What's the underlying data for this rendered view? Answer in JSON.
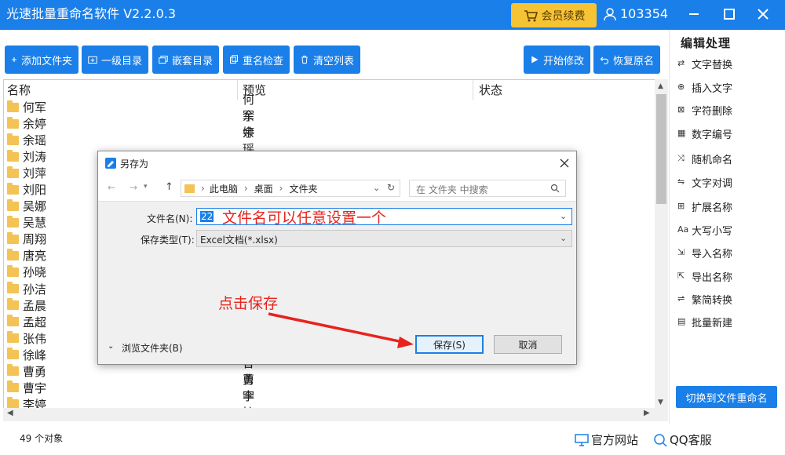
{
  "app": {
    "title": "光速批量重命名软件 V2.2.0.3",
    "vip_label": "会员续费",
    "user_id": "103354",
    "accent": "#1a7fe8",
    "vip_color": "#f6c335"
  },
  "toolbar": {
    "add_files": "添加文件夹",
    "first_level": "一级目录",
    "nested": "嵌套目录",
    "rename_check": "重名检查",
    "clear_list": "清空列表",
    "start": "开始修改",
    "restore": "恢复原名"
  },
  "list": {
    "columns": [
      "名称",
      "预览",
      "状态"
    ],
    "names": [
      "何军",
      "余婷",
      "余瑶",
      "刘涛",
      "刘萍",
      "刘阳",
      "吴娜",
      "吴慧",
      "周翔",
      "唐亮",
      "孙晓",
      "孙洁",
      "孟晨",
      "孟超",
      "张伟",
      "徐峰",
      "曹勇",
      "曹宇",
      "李婷"
    ],
    "previews": [
      "何军",
      "余婷",
      "余瑶",
      "",
      "",
      "",
      "",
      "",
      "",
      "",
      "",
      "",
      "",
      "",
      "",
      "",
      "曹勇",
      "曹宇",
      "李婷"
    ]
  },
  "sidebar": {
    "title": "编辑处理",
    "items": [
      {
        "label": "文字替换",
        "icon": "replace-icon"
      },
      {
        "label": "插入文字",
        "icon": "insert-icon"
      },
      {
        "label": "字符删除",
        "icon": "delete-char-icon"
      },
      {
        "label": "数字编号",
        "icon": "number-icon"
      },
      {
        "label": "随机命名",
        "icon": "shuffle-icon"
      },
      {
        "label": "文字对调",
        "icon": "swap-icon"
      },
      {
        "label": "扩展名称",
        "icon": "extension-icon"
      },
      {
        "label": "大写小写",
        "icon": "case-icon"
      },
      {
        "label": "导入名称",
        "icon": "import-icon"
      },
      {
        "label": "导出名称",
        "icon": "export-icon"
      },
      {
        "label": "繁简转换",
        "icon": "convert-icon"
      },
      {
        "label": "批量新建",
        "icon": "new-icon"
      }
    ],
    "switch_label": "切换到文件重命名"
  },
  "status": {
    "count": "49  个对象",
    "website": "官方网站",
    "qq": "QQ客服"
  },
  "dialog": {
    "title": "另存为",
    "breadcrumb": [
      "此电脑",
      "桌面",
      "文件夹"
    ],
    "search_placeholder": "在 文件夹 中搜索",
    "filename_label": "文件名(N):",
    "filename_value": "22",
    "filetype_label": "保存类型(T):",
    "filetype_value": "Excel文档(*.xlsx)",
    "browse_label": "浏览文件夹(B)",
    "save_label": "保存(S)",
    "cancel_label": "取消"
  },
  "annotations": {
    "filename_hint": "文件名可以任意设置一个",
    "save_hint": "点击保存"
  }
}
